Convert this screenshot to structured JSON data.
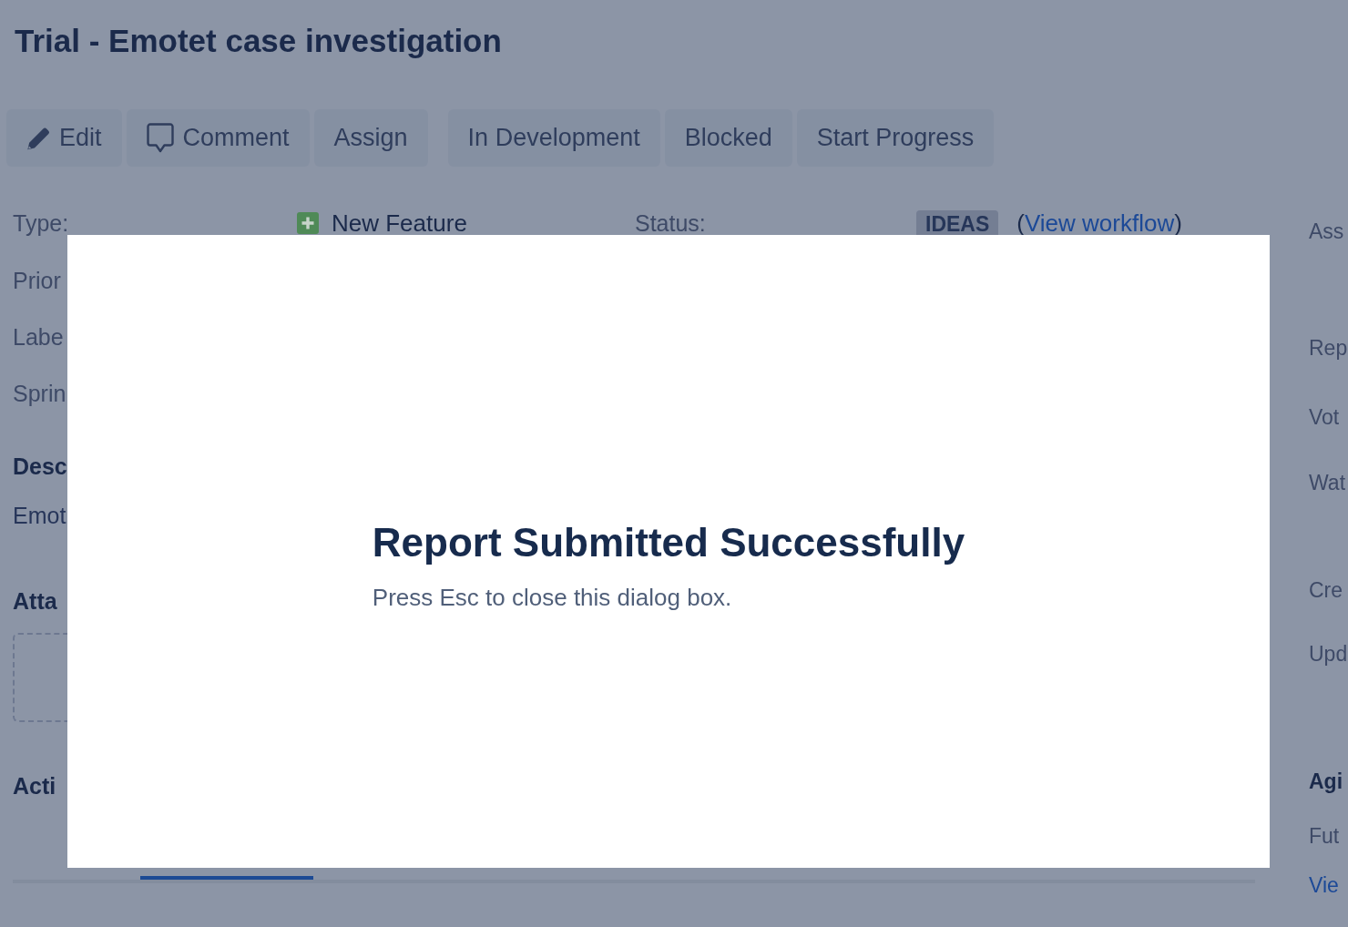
{
  "page": {
    "title": "Trial - Emotet case investigation"
  },
  "toolbar": {
    "groups": [
      [
        {
          "label": "Edit",
          "kind": "edit"
        },
        {
          "label": "Comment",
          "kind": "comment"
        },
        {
          "label": "Assign",
          "kind": "action"
        }
      ],
      [
        {
          "label": "In Development",
          "kind": "transition"
        },
        {
          "label": "Blocked",
          "kind": "transition"
        },
        {
          "label": "Start Progress",
          "kind": "transition"
        }
      ]
    ]
  },
  "details": {
    "type": {
      "label": "Type:",
      "value": "New Feature"
    },
    "status": {
      "label": "Status:",
      "value": "IDEAS",
      "link_open": "(",
      "link": "View workflow",
      "link_close": ")"
    },
    "fields": [
      "Prior",
      "Labe",
      "Sprin"
    ]
  },
  "description": {
    "heading": "Desc",
    "text": "Emot"
  },
  "attachments": {
    "heading": "Atta"
  },
  "activity": {
    "heading": "Acti",
    "tabs": [
      {
        "selected": false
      },
      {
        "selected": true
      }
    ]
  },
  "right_panel": {
    "people": [
      "Ass",
      "Rep",
      "Vot",
      "Wat"
    ],
    "dates": [
      "Cre",
      "Upd"
    ],
    "agile": {
      "heading": "Agi",
      "text": "Fut",
      "link": "Vie"
    }
  },
  "dialog": {
    "title": "Report Submitted Successfully",
    "message": "Press Esc to close this dialog box."
  }
}
